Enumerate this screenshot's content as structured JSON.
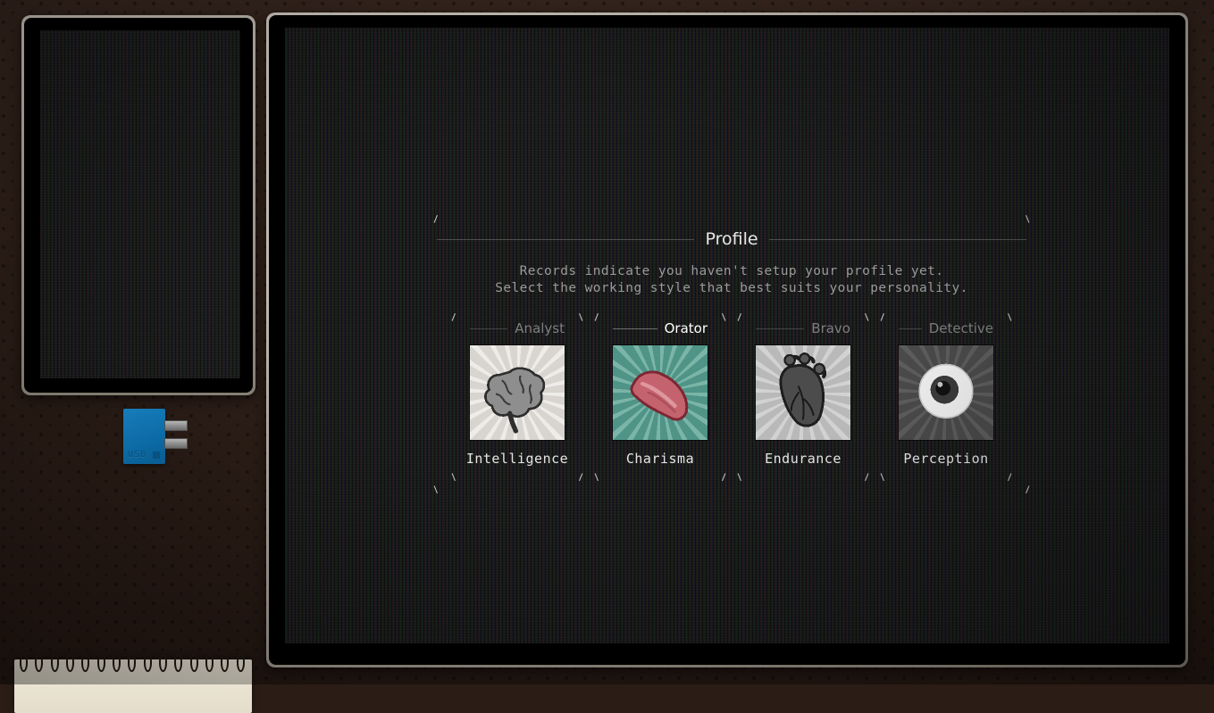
{
  "scene": {
    "desk_color": "#32221a",
    "screen_color": "#191a19"
  },
  "tablet": {
    "name": "tablet-device",
    "screen_content": ""
  },
  "usb_drive": {
    "label": "USB",
    "body_color": "#0f7ec2",
    "glyph": "usb-symbol"
  },
  "notepad": {
    "ring_count": 15,
    "paper_color": "#efe9da"
  },
  "monitor": {
    "dialog": {
      "title": "Profile",
      "description": "Records indicate you haven't setup your profile yet.\nSelect the working style that best suits your personality.",
      "cards": [
        {
          "role": "Analyst",
          "stat": "Intelligence",
          "icon": "brain-icon",
          "icon_bg": "#d8d4cf",
          "icon_ray": "#ffffff",
          "selected": false
        },
        {
          "role": "Orator",
          "stat": "Charisma",
          "icon": "tongue-icon",
          "icon_bg": "#4f9487",
          "icon_ray": "#9ecfc2",
          "selected": true
        },
        {
          "role": "Bravo",
          "stat": "Endurance",
          "icon": "heart-icon",
          "icon_bg": "#b9b9b9",
          "icon_ray": "#e8e8e8",
          "selected": false
        },
        {
          "role": "Detective",
          "stat": "Perception",
          "icon": "eye-icon",
          "icon_bg": "#4a4a4a",
          "icon_ray": "#6e6e6e",
          "selected": false
        }
      ]
    }
  }
}
